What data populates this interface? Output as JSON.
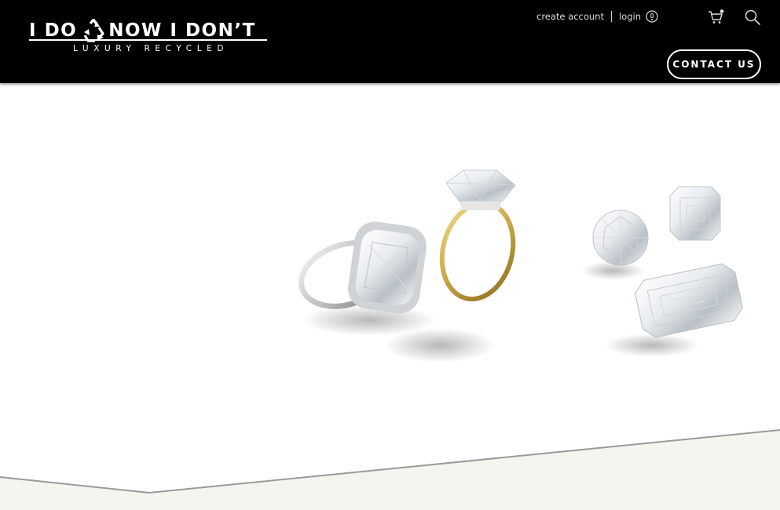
{
  "brand": {
    "name_left": "I DO",
    "name_right": "NOW I DON’T",
    "tagline": "LUXURY RECYCLED",
    "logo_icon": "recycle-icon"
  },
  "header": {
    "create_account_label": "create account",
    "login_label": "login",
    "login_icon": "user-icon",
    "cart_icon": "cart-icon",
    "search_icon": "search-icon",
    "contact_label": "CONTACT US"
  },
  "hero": {
    "image_subject": "diamond rings and loose diamonds"
  },
  "colors": {
    "header_bg": "#000000",
    "header_text": "#ffffff",
    "band": "#f6f4ef",
    "band_edge": "#9a9a9a",
    "gold": "#c9a64a",
    "platinum": "#d8d8d8"
  }
}
